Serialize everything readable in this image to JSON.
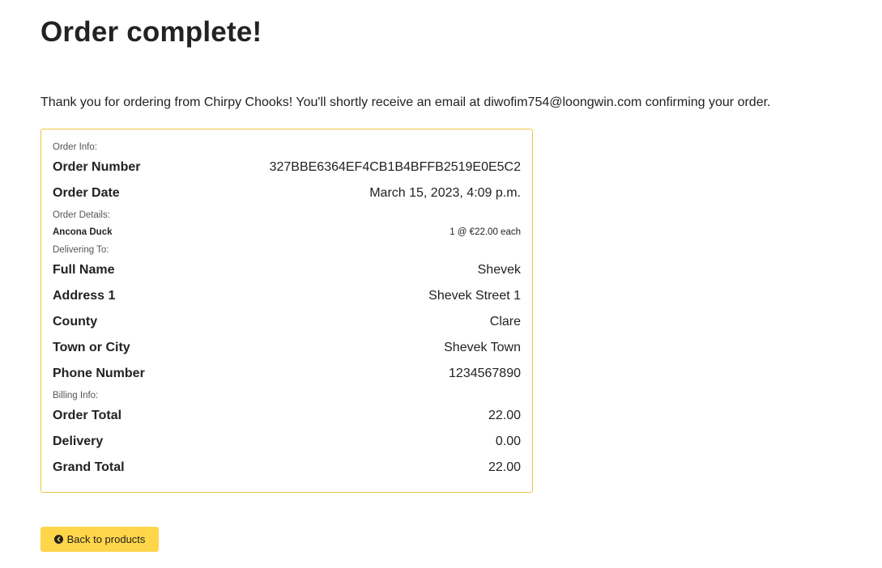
{
  "page": {
    "title": "Order complete!",
    "thank_you_message": "Thank you for ordering from Chirpy Chooks! You'll shortly receive an email at diwofim754@loongwin.com confirming your order."
  },
  "order_card": {
    "order_info_label": "Order Info:",
    "order_number_label": "Order Number",
    "order_number_value": "327BBE6364EF4CB1B4BFFB2519E0E5C2",
    "order_date_label": "Order Date",
    "order_date_value": "March 15, 2023, 4:09 p.m.",
    "order_details_label": "Order Details:",
    "items": [
      {
        "name": "Ancona Duck",
        "quantity_price": "1 @ €22.00 each"
      }
    ],
    "delivering_to_label": "Delivering To:",
    "full_name_label": "Full Name",
    "full_name_value": "Shevek",
    "address1_label": "Address 1",
    "address1_value": "Shevek Street 1",
    "county_label": "County",
    "county_value": "Clare",
    "town_label": "Town or City",
    "town_value": "Shevek Town",
    "phone_label": "Phone Number",
    "phone_value": "1234567890",
    "billing_info_label": "Billing Info:",
    "order_total_label": "Order Total",
    "order_total_value": "22.00",
    "delivery_label": "Delivery",
    "delivery_value": "0.00",
    "grand_total_label": "Grand Total",
    "grand_total_value": "22.00"
  },
  "back_button": {
    "label": "Back to products",
    "icon": "chevron-left-circle-icon"
  },
  "colors": {
    "card_border": "#f0c63f",
    "button_background": "#ffd54a"
  }
}
